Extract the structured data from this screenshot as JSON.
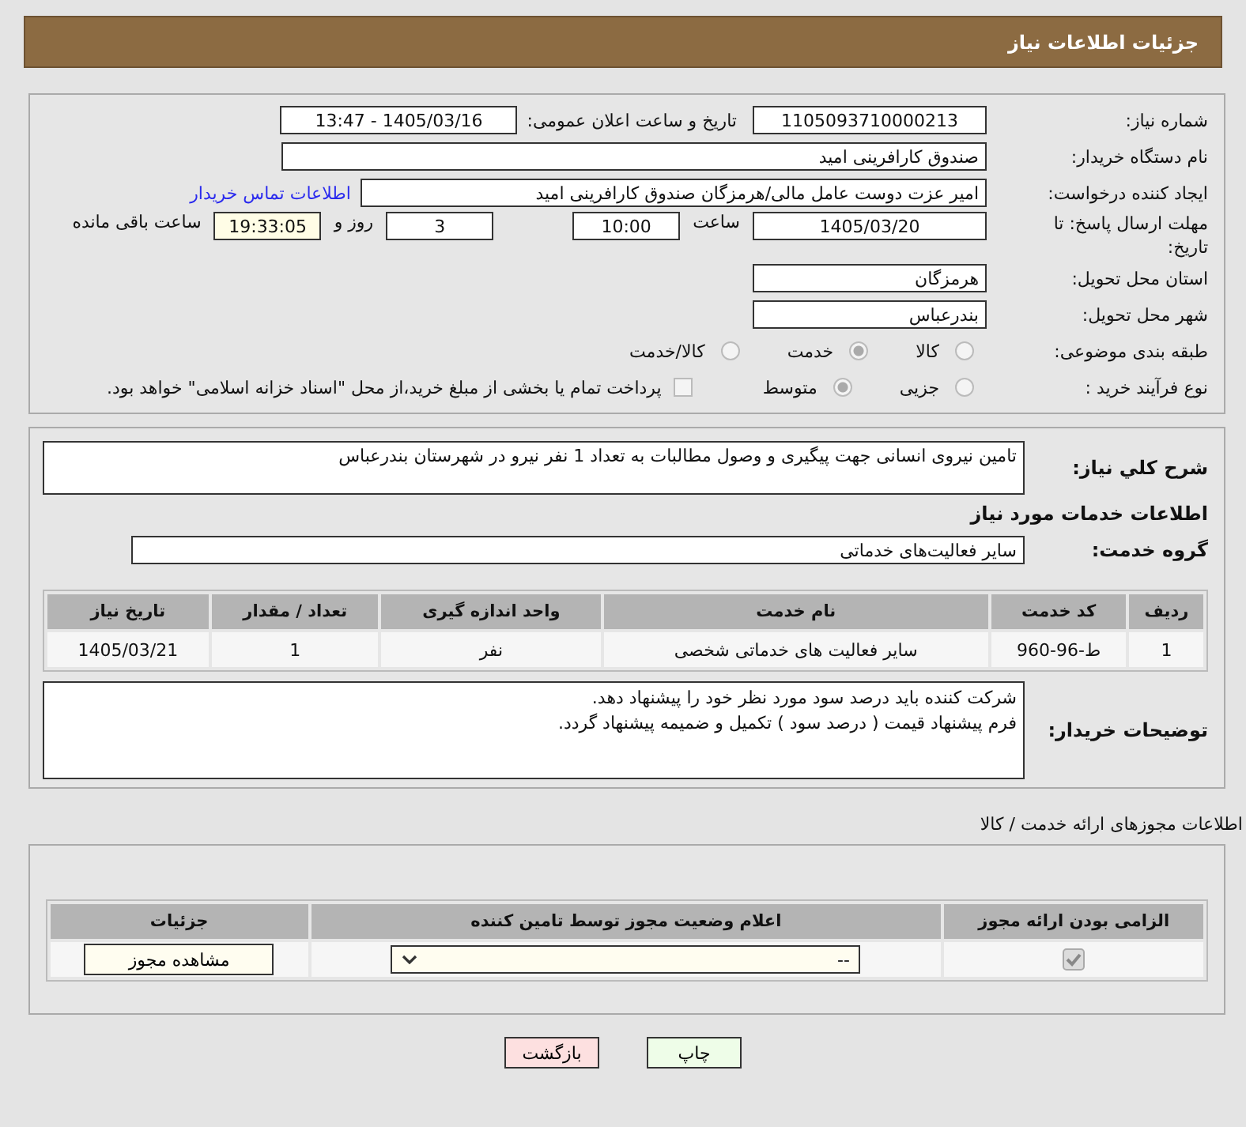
{
  "header": {
    "title": "جزئیات اطلاعات نیاز"
  },
  "details": {
    "need_number": {
      "label": "شماره نیاز:",
      "value": "1105093710000213"
    },
    "announce": {
      "label": "تاریخ و ساعت اعلان عمومی:",
      "value": "1405/03/16 - 13:47"
    },
    "buyer": {
      "label": "نام دستگاه خریدار:",
      "value": "صندوق کارافرینی امید"
    },
    "creator": {
      "label": "ایجاد کننده درخواست:",
      "value": "امیر عزت دوست عامل مالی/هرمزگان صندوق کارافرینی امید",
      "link": "اطلاعات تماس خریدار"
    },
    "deadline": {
      "label": "مهلت ارسال پاسخ: تا تاریخ:",
      "date": "1405/03/20",
      "time_label": "ساعت",
      "time": "10:00",
      "days": "3",
      "days_label": "روز و",
      "remaining": "19:33:05",
      "remaining_label": "ساعت باقی مانده"
    },
    "province": {
      "label": "استان محل تحویل:",
      "value": "هرمزگان"
    },
    "city": {
      "label": "شهر محل تحویل:",
      "value": "بندرعباس"
    },
    "category": {
      "label": "طبقه بندی موضوعی:",
      "options": [
        {
          "label": "کالا",
          "selected": false
        },
        {
          "label": "خدمت",
          "selected": true
        },
        {
          "label": "کالا/خدمت",
          "selected": false
        }
      ]
    },
    "process": {
      "label": "نوع فرآیند خرید :",
      "options": [
        {
          "label": "جزیی",
          "selected": false
        },
        {
          "label": "متوسط",
          "selected": true
        }
      ],
      "payment": {
        "label": "پرداخت تمام یا بخشی از مبلغ خرید،از محل \"اسناد خزانه اسلامی\" خواهد بود.",
        "checked": false
      }
    }
  },
  "summary": {
    "label": "شرح کلي نیاز:",
    "value": "تامین نیروی انسانی جهت پیگیری و وصول مطالبات به تعداد 1 نفر نیرو در شهرستان بندرعباس"
  },
  "services_title": "اطلاعات خدمات مورد نیاز",
  "service_group": {
    "label": "گروه خدمت:",
    "value": "سایر فعالیت‌های خدماتی"
  },
  "table": {
    "columns": [
      "ردیف",
      "کد خدمت",
      "نام خدمت",
      "واحد اندازه گیری",
      "تعداد / مقدار",
      "تاریخ نیاز"
    ],
    "rows": [
      [
        "1",
        "ط-96-960",
        "سایر فعالیت های خدماتی شخصی",
        "نفر",
        "1",
        "1405/03/21"
      ]
    ]
  },
  "buyer_notes": {
    "label": "توضیحات خریدار:",
    "lines": [
      "شرکت کننده باید درصد سود مورد نظر خود را پیشنهاد دهد.",
      "فرم پیشنهاد قیمت ( درصد سود ) تکمیل و ضمیمه پیشنهاد گردد."
    ]
  },
  "permits": {
    "title": "اطلاعات مجوزهای ارائه خدمت / کالا",
    "columns": [
      "الزامی بودن ارائه مجوز",
      "اعلام وضعیت مجوز توسط تامین کننده",
      "جزئیات"
    ],
    "rows": [
      {
        "required": true,
        "status": "--",
        "action": "مشاهده مجوز"
      }
    ]
  },
  "buttons": [
    {
      "label": "چاپ",
      "kind": "print"
    },
    {
      "label": "بازگشت",
      "kind": "back"
    }
  ]
}
